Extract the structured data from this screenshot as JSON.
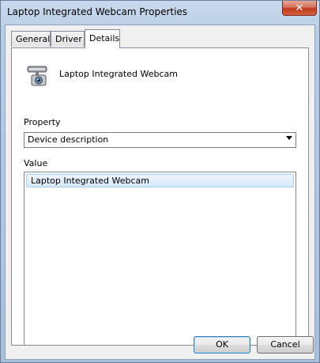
{
  "window": {
    "title": "Laptop Integrated Webcam Properties"
  },
  "tabs": [
    {
      "label": "General"
    },
    {
      "label": "Driver"
    },
    {
      "label": "Details"
    }
  ],
  "device": {
    "name": "Laptop Integrated Webcam",
    "icon": "webcam-icon"
  },
  "property": {
    "label": "Property",
    "selected": "Device description"
  },
  "value": {
    "label": "Value",
    "items": [
      "Laptop Integrated Webcam"
    ]
  },
  "buttons": {
    "ok": "OK",
    "cancel": "Cancel"
  },
  "colors": {
    "close_button": "#c9452c",
    "selection": "#d6e8fb"
  }
}
